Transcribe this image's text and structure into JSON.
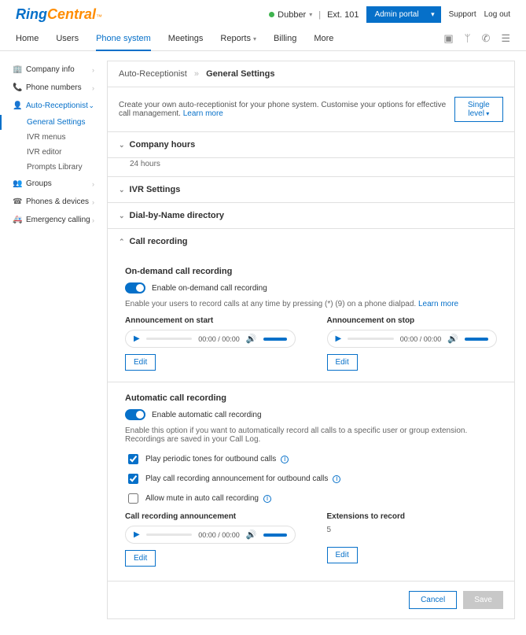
{
  "header": {
    "logo_ring": "Ring",
    "logo_central": "Central",
    "logo_tm": "™",
    "account_name": "Dubber",
    "ext_label": "Ext. 101",
    "portal_label": "Admin portal",
    "support": "Support",
    "logout": "Log out"
  },
  "nav": {
    "items": [
      "Home",
      "Users",
      "Phone system",
      "Meetings",
      "Reports",
      "Billing",
      "More"
    ],
    "active_index": 2,
    "icons": [
      "window-icon",
      "org-icon",
      "phone-icon",
      "list-icon"
    ]
  },
  "sidebar": {
    "items": [
      {
        "icon": "🏢",
        "label": "Company info"
      },
      {
        "icon": "📞",
        "label": "Phone numbers"
      },
      {
        "icon": "👤",
        "label": "Auto-Receptionist",
        "active": true,
        "expanded": true,
        "children": [
          {
            "label": "General Settings",
            "active": true
          },
          {
            "label": "IVR menus"
          },
          {
            "label": "IVR editor"
          },
          {
            "label": "Prompts Library"
          }
        ]
      },
      {
        "icon": "👥",
        "label": "Groups"
      },
      {
        "icon": "☎",
        "label": "Phones & devices"
      },
      {
        "icon": "🚑",
        "label": "Emergency calling"
      }
    ]
  },
  "breadcrumb": {
    "parent": "Auto-Receptionist",
    "current": "General Settings"
  },
  "intro": {
    "text": "Create your own auto-receptionist for your phone system. Customise your options for effective call management.",
    "learn_more": "Learn more",
    "level_btn": "Single level"
  },
  "sections": {
    "company_hours": {
      "title": "Company hours",
      "value": "24 hours"
    },
    "ivr": {
      "title": "IVR Settings"
    },
    "dbn": {
      "title": "Dial-by-Name directory"
    },
    "call_recording": {
      "title": "Call recording",
      "on_demand": {
        "heading": "On-demand call recording",
        "toggle_label": "Enable on-demand call recording",
        "help": "Enable your users to record calls at any time by pressing (*) (9) on a phone dialpad.",
        "learn_more": "Learn more",
        "ann_start_label": "Announcement on start",
        "ann_stop_label": "Announcement on stop",
        "time": "00:00 / 00:00",
        "edit": "Edit"
      },
      "automatic": {
        "heading": "Automatic call recording",
        "toggle_label": "Enable automatic call recording",
        "help": "Enable this option if you want to automatically record all calls to a specific user or group extension. Recordings are saved in your Call Log.",
        "opt_tones": "Play periodic tones for outbound calls",
        "opt_announce": "Play call recording announcement for outbound calls",
        "opt_mute": "Allow mute in auto call recording",
        "ann_label": "Call recording announcement",
        "time": "00:00 / 00:00",
        "edit": "Edit",
        "ext_label": "Extensions to record",
        "ext_value": "5"
      }
    }
  },
  "footer": {
    "cancel": "Cancel",
    "save": "Save"
  }
}
